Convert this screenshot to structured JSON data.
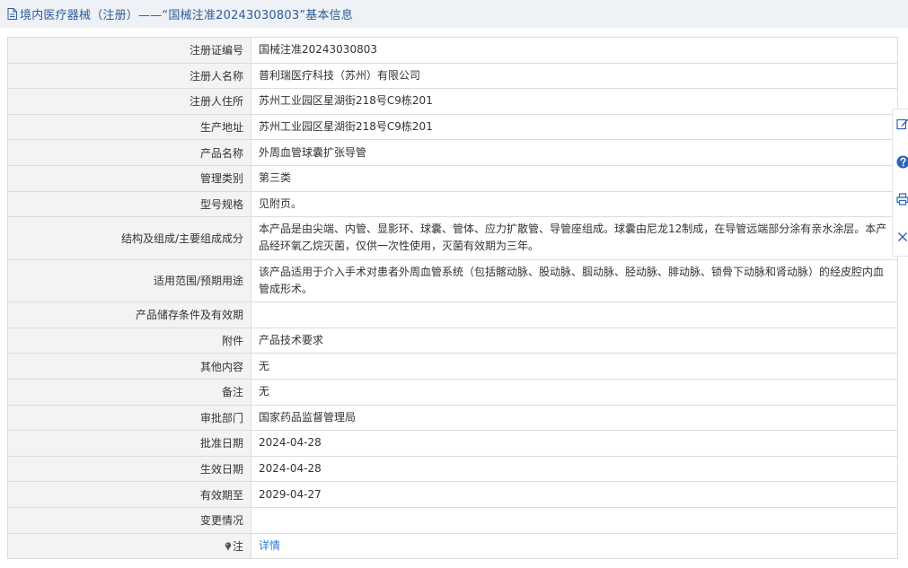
{
  "header": {
    "title": "境内医疗器械（注册）——“国械注准20243030803”基本信息"
  },
  "rows": [
    {
      "label": "注册证编号",
      "value": "国械注准20243030803"
    },
    {
      "label": "注册人名称",
      "value": "普利瑞医疗科技（苏州）有限公司"
    },
    {
      "label": "注册人住所",
      "value": "苏州工业园区星湖街218号C9栋201"
    },
    {
      "label": "生产地址",
      "value": "苏州工业园区星湖街218号C9栋201"
    },
    {
      "label": "产品名称",
      "value": "外周血管球囊扩张导管"
    },
    {
      "label": "管理类别",
      "value": "第三类"
    },
    {
      "label": "型号规格",
      "value": "见附页。"
    },
    {
      "label": "结构及组成/主要组成成分",
      "value": "本产品是由尖端、内管、显影环、球囊、管体、应力扩散管、导管座组成。球囊由尼龙12制成，在导管远端部分涂有亲水涂层。本产品经环氧乙烷灭菌，仅供一次性使用，灭菌有效期为三年。"
    },
    {
      "label": "适用范围/预期用途",
      "value": "该产品适用于介入手术对患者外周血管系统（包括髂动脉、股动脉、腘动脉、胫动脉、腓动脉、锁骨下动脉和肾动脉）的经皮腔内血管成形术。"
    },
    {
      "label": "产品储存条件及有效期",
      "value": ""
    },
    {
      "label": "附件",
      "value": "产品技术要求"
    },
    {
      "label": "其他内容",
      "value": "无"
    },
    {
      "label": "备注",
      "value": "无"
    },
    {
      "label": "审批部门",
      "value": "国家药品监督管理局"
    },
    {
      "label": "批准日期",
      "value": "2024-04-28"
    },
    {
      "label": "生效日期",
      "value": "2024-04-28"
    },
    {
      "label": "有效期至",
      "value": "2029-04-27"
    },
    {
      "label": "变更情况",
      "value": ""
    },
    {
      "label": "注",
      "value": "详情"
    }
  ],
  "icons": {
    "header": "document-icon",
    "note": "pin-icon",
    "side_tools": [
      "edit-icon",
      "help-icon",
      "print-icon",
      "close-icon"
    ]
  },
  "colors": {
    "header_bg": "#eef1f5",
    "header_text": "#2b5d9b",
    "label_bg": "#f3f3f3",
    "link": "#2b7bd6",
    "side_icon": "#2b63b8"
  }
}
